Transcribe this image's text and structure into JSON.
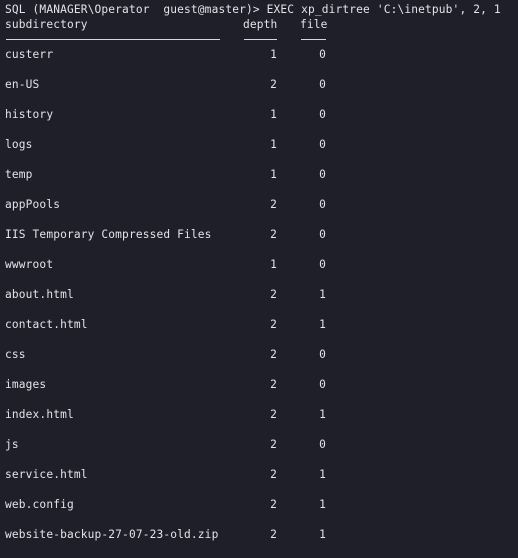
{
  "prompt": {
    "text": "SQL (MANAGER\\Operator  guest@master)> EXEC xp_dirtree 'C:\\inetpub', 2, 1"
  },
  "table": {
    "headers": {
      "subdirectory": "subdirectory",
      "depth": "depth",
      "file": "file"
    },
    "rows": [
      {
        "subdirectory": "custerr",
        "depth": "1",
        "file": "0"
      },
      {
        "subdirectory": "en-US",
        "depth": "2",
        "file": "0"
      },
      {
        "subdirectory": "history",
        "depth": "1",
        "file": "0"
      },
      {
        "subdirectory": "logs",
        "depth": "1",
        "file": "0"
      },
      {
        "subdirectory": "temp",
        "depth": "1",
        "file": "0"
      },
      {
        "subdirectory": "appPools",
        "depth": "2",
        "file": "0"
      },
      {
        "subdirectory": "IIS Temporary Compressed Files",
        "depth": "2",
        "file": "0"
      },
      {
        "subdirectory": "wwwroot",
        "depth": "1",
        "file": "0"
      },
      {
        "subdirectory": "about.html",
        "depth": "2",
        "file": "1"
      },
      {
        "subdirectory": "contact.html",
        "depth": "2",
        "file": "1"
      },
      {
        "subdirectory": "css",
        "depth": "2",
        "file": "0"
      },
      {
        "subdirectory": "images",
        "depth": "2",
        "file": "0"
      },
      {
        "subdirectory": "index.html",
        "depth": "2",
        "file": "1"
      },
      {
        "subdirectory": "js",
        "depth": "2",
        "file": "0"
      },
      {
        "subdirectory": "service.html",
        "depth": "2",
        "file": "1"
      },
      {
        "subdirectory": "web.config",
        "depth": "2",
        "file": "1"
      },
      {
        "subdirectory": "website-backup-27-07-23-old.zip",
        "depth": "2",
        "file": "1"
      }
    ]
  }
}
